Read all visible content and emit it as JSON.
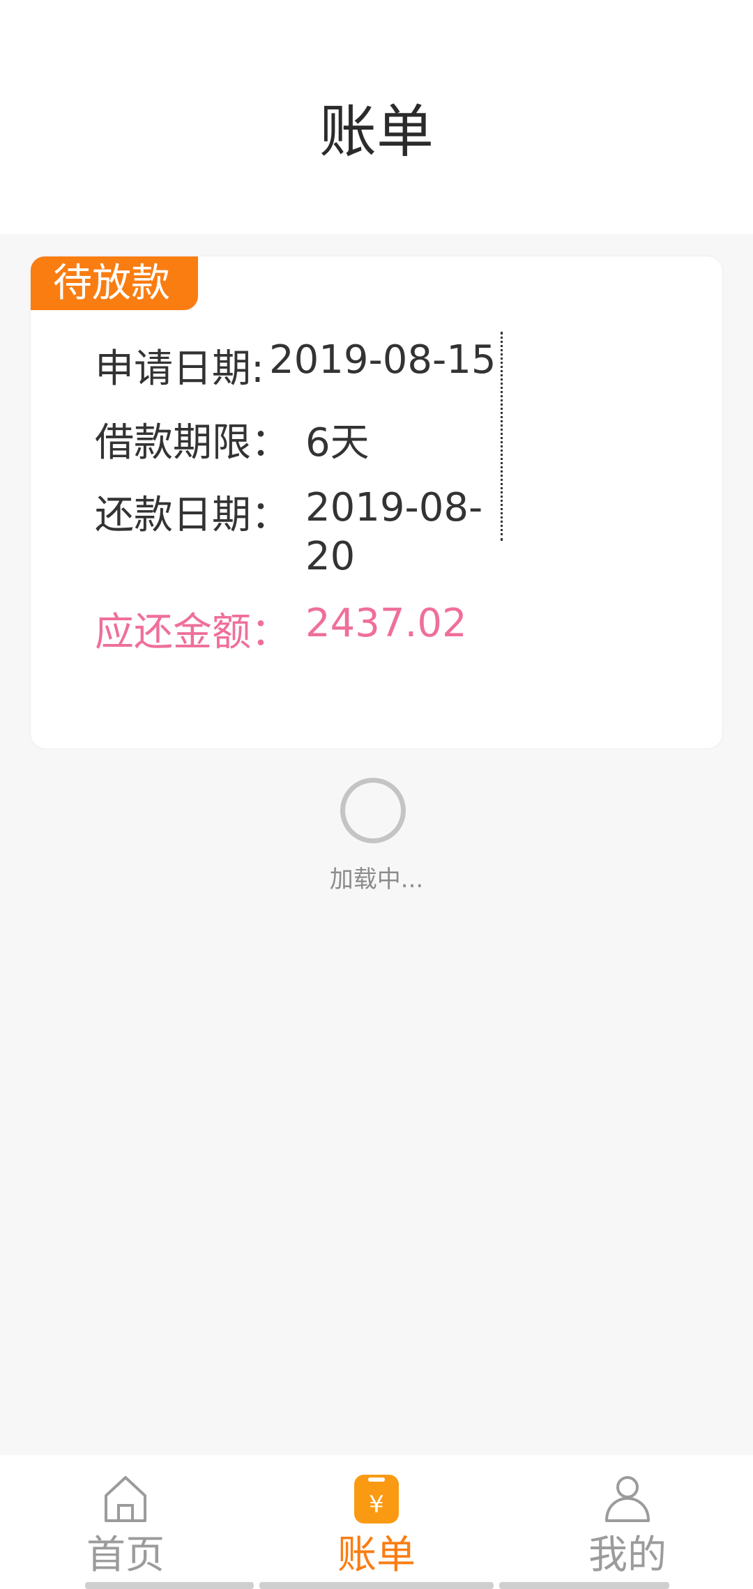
{
  "header": {
    "title": "账单"
  },
  "colors": {
    "accent": "#fa7d12",
    "amount": "#ef6f9a",
    "status_dot": "#5cc96f",
    "tab_inactive": "#9b9b9b"
  },
  "bill_card": {
    "status_badge": "待放款",
    "apply_date_label": "申请日期:",
    "apply_date": "2019-08-15",
    "term_label": "借款期限：",
    "term": "6天",
    "repay_date_label": "还款日期：",
    "repay_date": "2019-08-20",
    "amount_label": "应还金额：",
    "amount": "2437.02"
  },
  "loading": {
    "text": "加载中..."
  },
  "tabbar": {
    "items": [
      {
        "label": "首页",
        "icon": "home-icon",
        "active": false
      },
      {
        "label": "账单",
        "icon": "bill-icon",
        "active": true
      },
      {
        "label": "我的",
        "icon": "user-icon",
        "active": false
      }
    ]
  }
}
